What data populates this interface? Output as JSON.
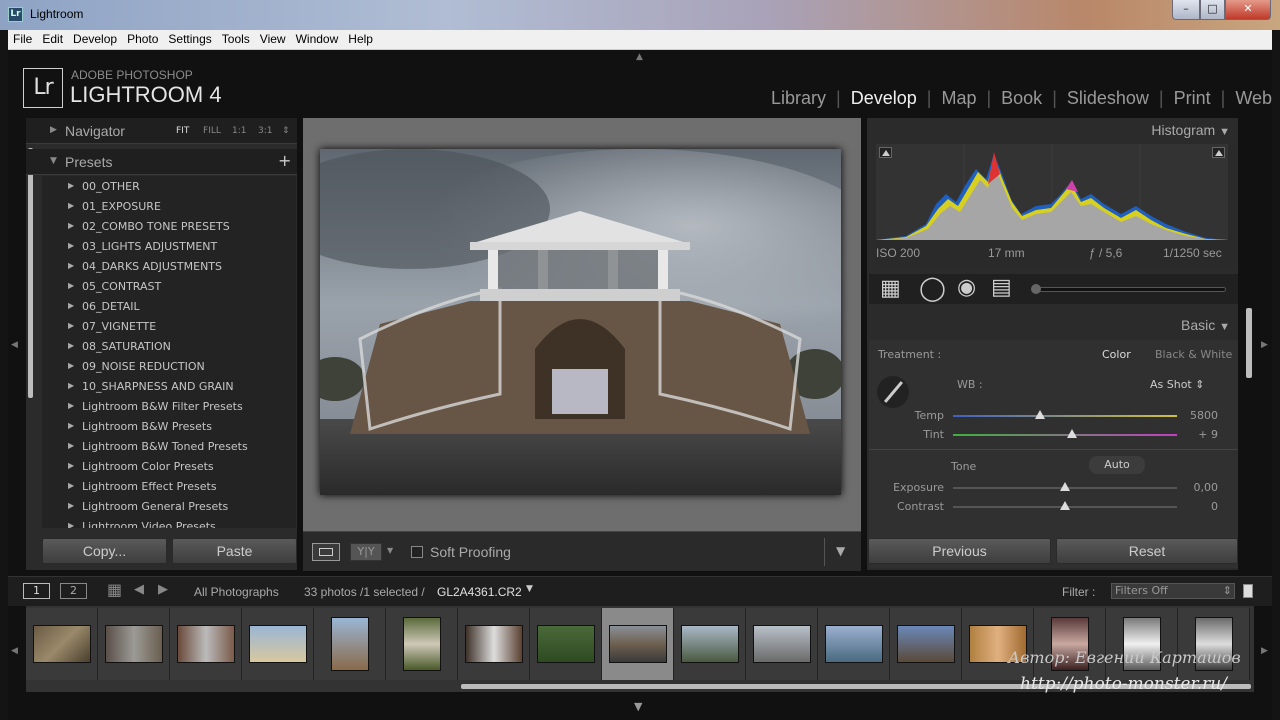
{
  "window": {
    "title": "Lightroom",
    "icon_label": "Lr",
    "minimize": "–",
    "maximize": "□",
    "close": "✕"
  },
  "menu": [
    "File",
    "Edit",
    "Develop",
    "Photo",
    "Settings",
    "Tools",
    "View",
    "Window",
    "Help"
  ],
  "brand": {
    "logo": "Lr",
    "line1": "ADOBE PHOTOSHOP",
    "line2": "LIGHTROOM 4"
  },
  "modules": [
    "Library",
    "Develop",
    "Map",
    "Book",
    "Slideshow",
    "Print",
    "Web"
  ],
  "active_module": "Develop",
  "navigator": {
    "label": "Navigator",
    "options": [
      "FIT",
      "FILL",
      "1:1",
      "3:1"
    ]
  },
  "presets": {
    "label": "Presets",
    "add": "+",
    "items": [
      "00_OTHER",
      "01_EXPOSURE",
      "02_COMBO TONE PRESETS",
      "03_LIGHTS ADJUSTMENT",
      "04_DARKS ADJUSTMENTS",
      "05_CONTRAST",
      "06_DETAIL",
      "07_VIGNETTE",
      "08_SATURATION",
      "09_NOISE REDUCTION",
      "10_SHARPNESS AND GRAIN",
      "Lightroom B&W Filter Presets",
      "Lightroom B&W Presets",
      "Lightroom B&W Toned Presets",
      "Lightroom Color Presets",
      "Lightroom Effect Presets",
      "Lightroom General Presets",
      "Lightroom Video Presets"
    ]
  },
  "left_buttons": {
    "copy": "Copy...",
    "paste": "Paste"
  },
  "toolbar": {
    "yy": "Y|Y",
    "soft_proofing": "Soft Proofing",
    "dropdown": "▼"
  },
  "histogram": {
    "label": "Histogram",
    "iso": "ISO 200",
    "focal": "17 mm",
    "aperture": "ƒ / 5,6",
    "shutter": "1/1250 sec"
  },
  "basic": {
    "label": "Basic",
    "treatment_label": "Treatment :",
    "treatment_color": "Color",
    "treatment_bw": "Black & White",
    "wb_label": "WB :",
    "wb_value": "As Shot",
    "temp": {
      "label": "Temp",
      "value": "5800",
      "fraction": 0.39
    },
    "tint": {
      "label": "Tint",
      "value": "+ 9",
      "fraction": 0.53
    },
    "tone_label": "Tone",
    "auto": "Auto",
    "exposure": {
      "label": "Exposure",
      "value": "0,00",
      "fraction": 0.5
    },
    "contrast": {
      "label": "Contrast",
      "value": "0",
      "fraction": 0.5
    }
  },
  "right_buttons": {
    "previous": "Previous",
    "reset": "Reset"
  },
  "filmbar": {
    "page1": "1",
    "page2": "2",
    "source": "All Photographs",
    "count": "33 photos /1 selected /",
    "filename": "GL2A4361.CR2",
    "filter_label": "Filter :",
    "filter_value": "Filters Off"
  },
  "colors": {
    "accent_active": "#f0f0f0",
    "panel_bg": "#2b2b2b",
    "center_bg": "#6e6e6e"
  },
  "watermark": {
    "line1": "Автор: Евгений Карташов",
    "line2": "http://photo-monster.ru/"
  }
}
